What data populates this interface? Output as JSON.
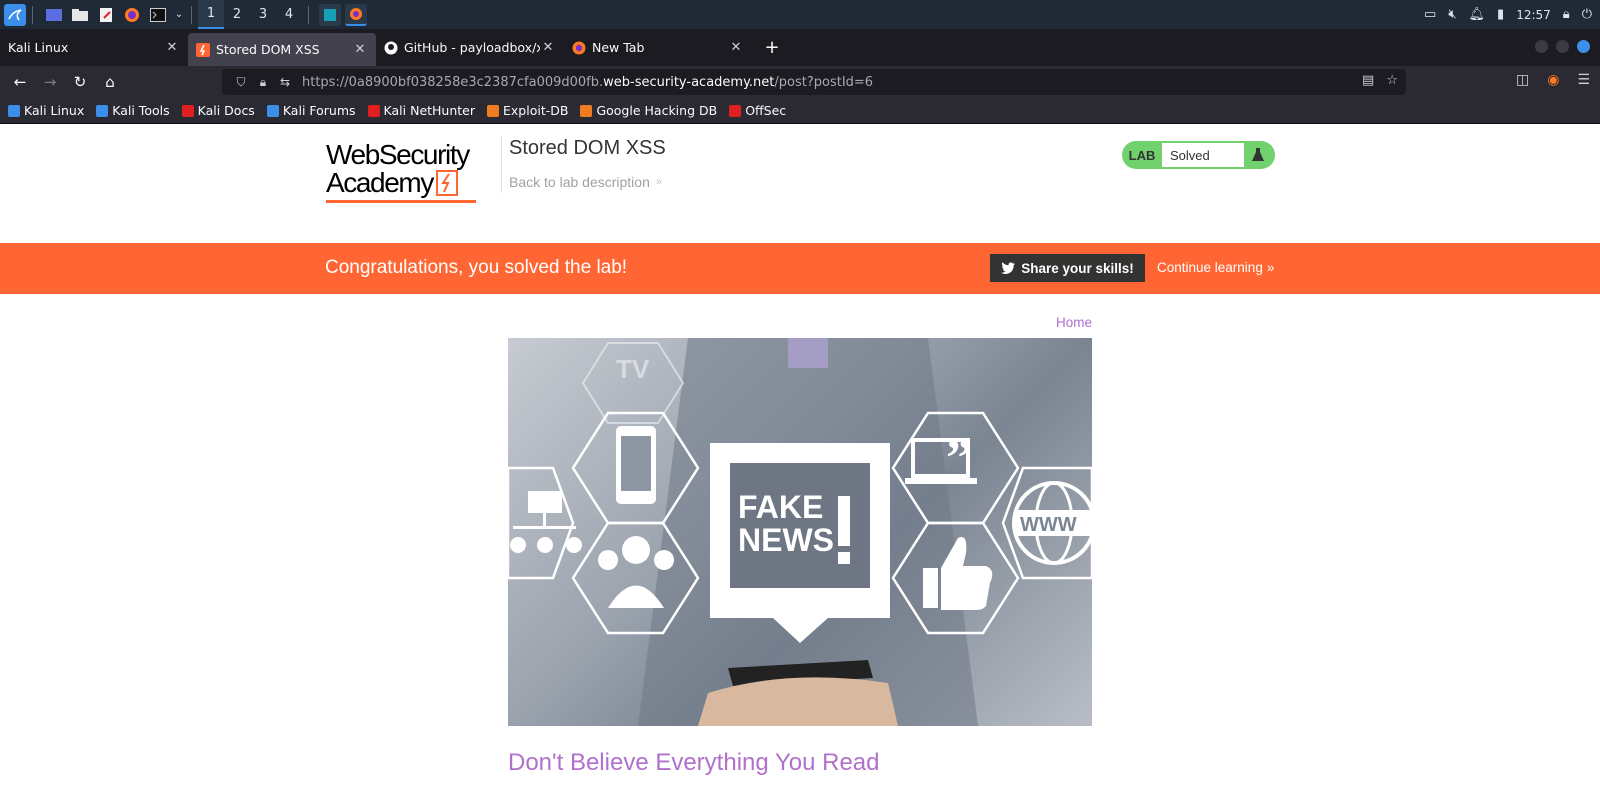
{
  "taskbar": {
    "workspaces": [
      "1",
      "2",
      "3",
      "4"
    ],
    "clock": "12:57"
  },
  "tabs": [
    {
      "title": "Kali Linux",
      "active": false
    },
    {
      "title": "Stored DOM XSS",
      "active": true
    },
    {
      "title": "GitHub - payloadbox/xss-p",
      "active": false
    },
    {
      "title": "New Tab",
      "active": false
    }
  ],
  "url": {
    "prefix": "https://0a8900bf038258e3c2387cfa009d00fb.",
    "domain": "web-security-academy.net",
    "path": "/post?postId=6"
  },
  "bookmarks": [
    {
      "label": "Kali Linux",
      "color": "#3b8eea"
    },
    {
      "label": "Kali Tools",
      "color": "#3b8eea"
    },
    {
      "label": "Kali Docs",
      "color": "#e02020"
    },
    {
      "label": "Kali Forums",
      "color": "#3b8eea"
    },
    {
      "label": "Kali NetHunter",
      "color": "#e02020"
    },
    {
      "label": "Exploit-DB",
      "color": "#f07c22"
    },
    {
      "label": "Google Hacking DB",
      "color": "#f07c22"
    },
    {
      "label": "OffSec",
      "color": "#e02020"
    }
  ],
  "header": {
    "logo_line1": "WebSecurity",
    "logo_line2": "Academy",
    "lab_title": "Stored DOM XSS",
    "back_link": "Back to lab description",
    "lab_badge": "LAB",
    "lab_state": "Solved"
  },
  "banner": {
    "message": "Congratulations, you solved the lab!",
    "share_button": "Share your skills!",
    "continue_link": "Continue learning"
  },
  "post": {
    "home_link": "Home",
    "image_text_line1": "FAKE",
    "image_text_line2": "NEWS",
    "image_text_www": "WWW",
    "image_text_tv": "TV",
    "title": "Don't Believe Everything You Read"
  },
  "colors": {
    "accent": "#ff6633",
    "link_purple": "#b170cc",
    "solved_green": "#70d16d"
  }
}
